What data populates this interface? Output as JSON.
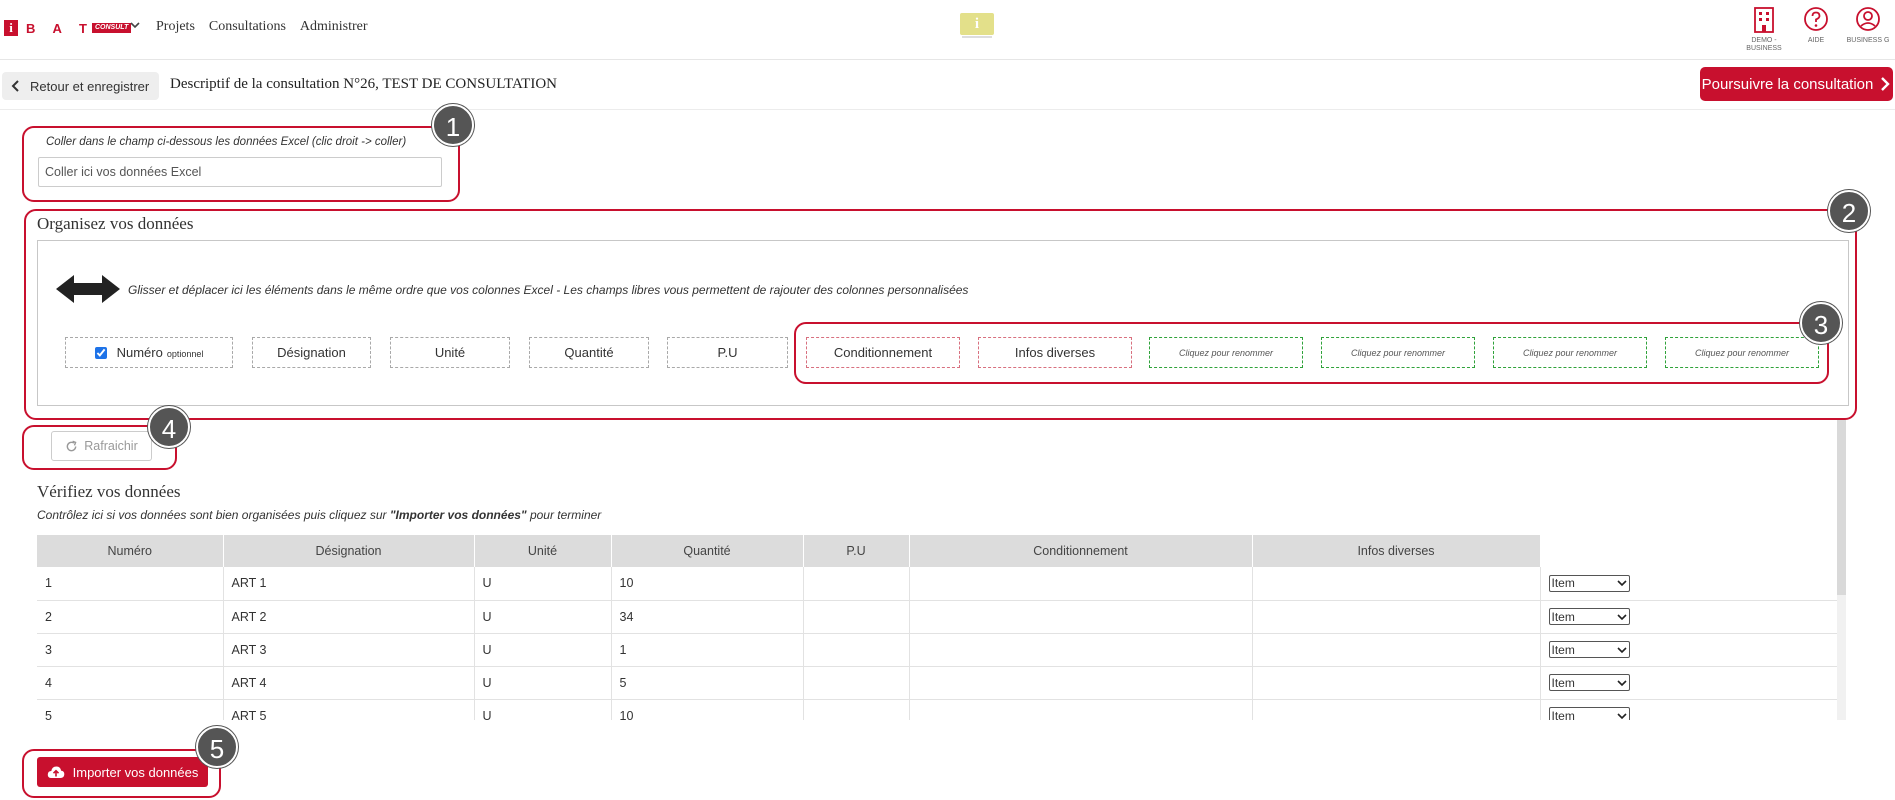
{
  "header": {
    "logo_letters": "B A T",
    "logo_badge": "CONSULT",
    "nav": [
      "Projets",
      "Consultations",
      "Administrer"
    ],
    "info_badge": "i",
    "icons": [
      {
        "name": "company-icon",
        "label": "DEMO - BUSINESS"
      },
      {
        "name": "help-icon",
        "label": "Aide"
      },
      {
        "name": "user-icon",
        "label": "BUSINESS G"
      }
    ]
  },
  "subheader": {
    "back_label": "Retour et enregistrer",
    "title": "Descriptif de la consultation N°26, TEST DE CONSULTATION",
    "continue_label": "Poursuivre la consultation"
  },
  "paste": {
    "help": "Coller dans le champ ci-dessous les données Excel (clic droit -> coller)",
    "placeholder": "Coller ici vos données Excel"
  },
  "organize": {
    "title": "Organisez vos données",
    "help": "Glisser et déplacer ici les éléments dans le même ordre que vos colonnes Excel - Les champs libres vous permettent de rajouter des colonnes personnalisées",
    "numero_label": "Numéro",
    "numero_optional": "optionnel",
    "numero_checked": true,
    "columns": [
      "Désignation",
      "Unité",
      "Quantité",
      "P.U"
    ],
    "extra_columns": [
      "Conditionnement",
      "Infos diverses"
    ],
    "free_columns": [
      "Cliquez pour renommer",
      "Cliquez pour renommer",
      "Cliquez pour renommer",
      "Cliquez pour renommer"
    ]
  },
  "refresh_label": "Rafraichir",
  "verify": {
    "title": "Vérifiez vos données",
    "help_before": "Contrôlez ici si vos données sont bien organisées puis cliquez sur ",
    "help_bold": "\"Importer vos données\"",
    "help_after": " pour terminer",
    "headers": [
      "Numéro",
      "Désignation",
      "Unité",
      "Quantité",
      "P.U",
      "Conditionnement",
      "Infos diverses",
      ""
    ],
    "rows": [
      {
        "numero": "1",
        "designation": "ART 1",
        "unite": "U",
        "quantite": "10",
        "type": "Item"
      },
      {
        "numero": "2",
        "designation": "ART 2",
        "unite": "U",
        "quantite": "34",
        "type": "Item"
      },
      {
        "numero": "3",
        "designation": "ART 3",
        "unite": "U",
        "quantite": "1",
        "type": "Item"
      },
      {
        "numero": "4",
        "designation": "ART 4",
        "unite": "U",
        "quantite": "5",
        "type": "Item"
      },
      {
        "numero": "5",
        "designation": "ART 5",
        "unite": "U",
        "quantite": "10",
        "type": "Item"
      }
    ]
  },
  "import_label": "Importer vos données",
  "steps": [
    "1",
    "2",
    "3",
    "4",
    "5"
  ],
  "colors": {
    "brand": "#c8102e",
    "step_badge": "#555555",
    "free_field_border": "#2fa23a"
  }
}
